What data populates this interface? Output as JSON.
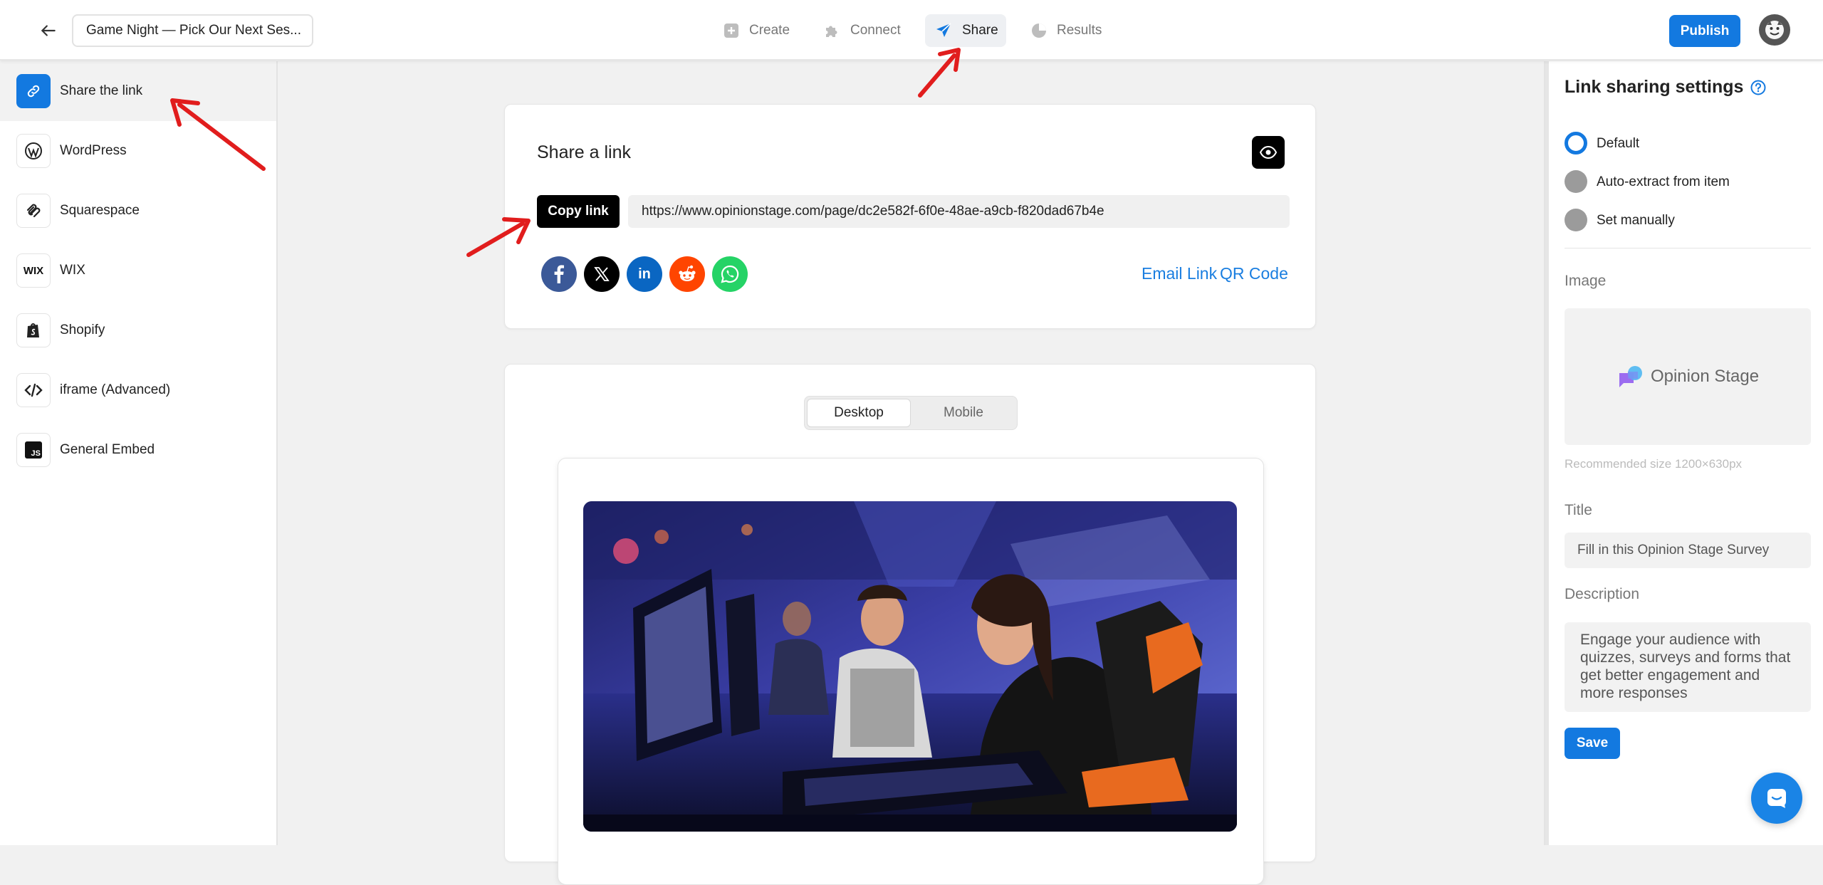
{
  "header": {
    "title": "Game Night — Pick Our Next Ses...",
    "tabs": [
      {
        "label": "Create",
        "icon": "plus-square-icon",
        "active": false
      },
      {
        "label": "Connect",
        "icon": "puzzle-icon",
        "active": false
      },
      {
        "label": "Share",
        "icon": "send-icon",
        "active": true
      },
      {
        "label": "Results",
        "icon": "pie-chart-icon",
        "active": false
      }
    ],
    "publish_label": "Publish"
  },
  "sidebar": {
    "items": [
      {
        "label": "Share the link",
        "icon": "link-icon",
        "active": true
      },
      {
        "label": "WordPress",
        "icon": "wordpress-icon",
        "active": false
      },
      {
        "label": "Squarespace",
        "icon": "squarespace-icon",
        "active": false
      },
      {
        "label": "WIX",
        "icon": "wix-icon",
        "icon_text": "WIX",
        "active": false
      },
      {
        "label": "Shopify",
        "icon": "shopify-icon",
        "active": false
      },
      {
        "label": "iframe (Advanced)",
        "icon": "code-icon",
        "active": false
      },
      {
        "label": "General Embed",
        "icon": "js-icon",
        "icon_text": "JS",
        "active": false
      }
    ]
  },
  "share_card": {
    "title": "Share a link",
    "copy_label": "Copy link",
    "url": "https://www.opinionstage.com/page/dc2e582f-6f0e-48ae-a9cb-f820dad67b4e",
    "social": [
      "facebook-icon",
      "x-icon",
      "linkedin-icon",
      "reddit-icon",
      "whatsapp-icon"
    ],
    "social_colors": [
      "#3b5998",
      "#000000",
      "#0a66c2",
      "#ff4500",
      "#25d366"
    ],
    "email_link_label": "Email Link",
    "qr_code_label": "QR Code"
  },
  "preview": {
    "tabs": [
      "Desktop",
      "Mobile"
    ],
    "selected": "Desktop"
  },
  "settings": {
    "title": "Link sharing settings",
    "options": [
      {
        "label": "Default",
        "selected": true
      },
      {
        "label": "Auto-extract from item",
        "selected": false
      },
      {
        "label": "Set manually",
        "selected": false
      }
    ],
    "image_label": "Image",
    "logo_text": "Opinion Stage",
    "image_hint": "Recommended size 1200×630px",
    "title_label": "Title",
    "title_value": "Fill in this Opinion Stage Survey",
    "description_label": "Description",
    "description_value": "Engage your audience with quizzes, surveys and forms that get better engagement and more responses",
    "save_label": "Save"
  },
  "colors": {
    "accent": "#1379e0",
    "annotation_arrow": "#e11d1d"
  }
}
